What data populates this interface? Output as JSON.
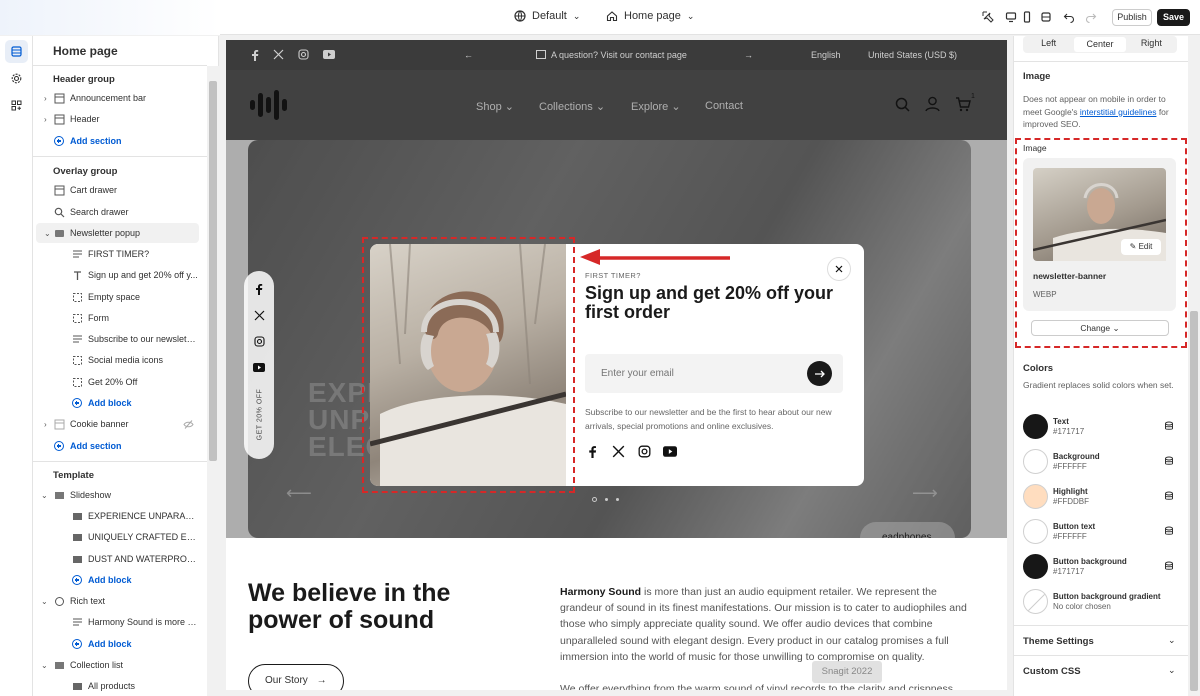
{
  "topbar": {
    "theme": "Default",
    "page": "Home page",
    "publish": "Publish",
    "save": "Save"
  },
  "sidebar": {
    "title": "Home page",
    "header_group": {
      "title": "Header group",
      "items": [
        "Announcement bar",
        "Header"
      ],
      "add": "Add section"
    },
    "overlay_group": {
      "title": "Overlay group",
      "items": [
        "Cart drawer",
        "Search drawer",
        "Newsletter popup"
      ],
      "popup_blocks": [
        "FIRST TIMER?",
        "Sign up and get 20% off y...",
        "Empty space",
        "Form",
        "Subscribe to our newslette...",
        "Social media icons",
        "Get 20% Off"
      ],
      "add_block": "Add block",
      "cookie": "Cookie banner",
      "add": "Add section"
    },
    "template": {
      "title": "Template",
      "slideshow": "Slideshow",
      "slides": [
        "EXPERIENCE UNPARALLELE...",
        "UNIQUELY CRAFTED EAR...",
        "DUST AND WATERPROOF"
      ],
      "add_block": "Add block",
      "rich_text": "Rich text",
      "rich_items": [
        "Harmony Sound is more th..."
      ],
      "add_block2": "Add block",
      "collection": "Collection list",
      "collection_items": [
        "All products"
      ]
    }
  },
  "preview": {
    "announce": "A question? Visit our contact page",
    "language": "English",
    "currency": "United States (USD $)",
    "nav": [
      "Shop",
      "Collections",
      "Explore",
      "Contact"
    ],
    "cart_count": "1",
    "hero_lines": [
      "EXPER",
      "UNPAR",
      "ELEGA"
    ],
    "hero_vertical": "GET 20% OFF",
    "hero_button": "eadphones",
    "popup": {
      "kicker": "FIRST TIMER?",
      "title": "Sign up and get 20% off your first order",
      "placeholder": "Enter your email",
      "desc": "Subscribe to our newsletter and be the first to hear about our new arrivals, special promotions and online exclusives."
    },
    "body_heading": "We believe in the power of sound",
    "body_brand": "Harmony Sound",
    "body_text": " is more than just an audio equipment retailer. We represent the grandeur of sound in its finest manifestations. Our mission is to cater to audiophiles and those who simply appreciate quality sound. We offer audio devices that combine unparalleled sound with elegant design. Every product in our catalog promises a full immersion into the world of music for those unwilling to compromise on quality.",
    "body_text2": "We offer everything from the warm sound of vinyl records to the clarity and crispness",
    "story_button": "Our Story",
    "watermark": "Snagit 2022"
  },
  "right_panel": {
    "alignment": [
      "Left",
      "Center",
      "Right"
    ],
    "image_heading": "Image",
    "image_note_pre": "Does not appear on mobile in order to meet Google's ",
    "image_note_link": "interstitial guidelines",
    "image_note_post": " for improved SEO.",
    "image_label": "Image",
    "edit": "Edit",
    "file_name": "newsletter-banner",
    "file_type": "WEBP",
    "change": "Change",
    "colors_heading": "Colors",
    "colors_note": "Gradient replaces solid colors when set.",
    "colors": [
      {
        "name": "Text",
        "value": "#171717",
        "hex": "#171717"
      },
      {
        "name": "Background",
        "value": "#FFFFFF",
        "hex": "#FFFFFF"
      },
      {
        "name": "Highlight",
        "value": "#FFDDBF",
        "hex": "#FFDDBF"
      },
      {
        "name": "Button text",
        "value": "#FFFFFF",
        "hex": "#FFFFFF"
      },
      {
        "name": "Button background",
        "value": "#171717",
        "hex": "#171717"
      },
      {
        "name": "Button background gradient",
        "value": "No color chosen",
        "hex": ""
      }
    ],
    "theme_settings": "Theme Settings",
    "custom_css": "Custom CSS"
  }
}
